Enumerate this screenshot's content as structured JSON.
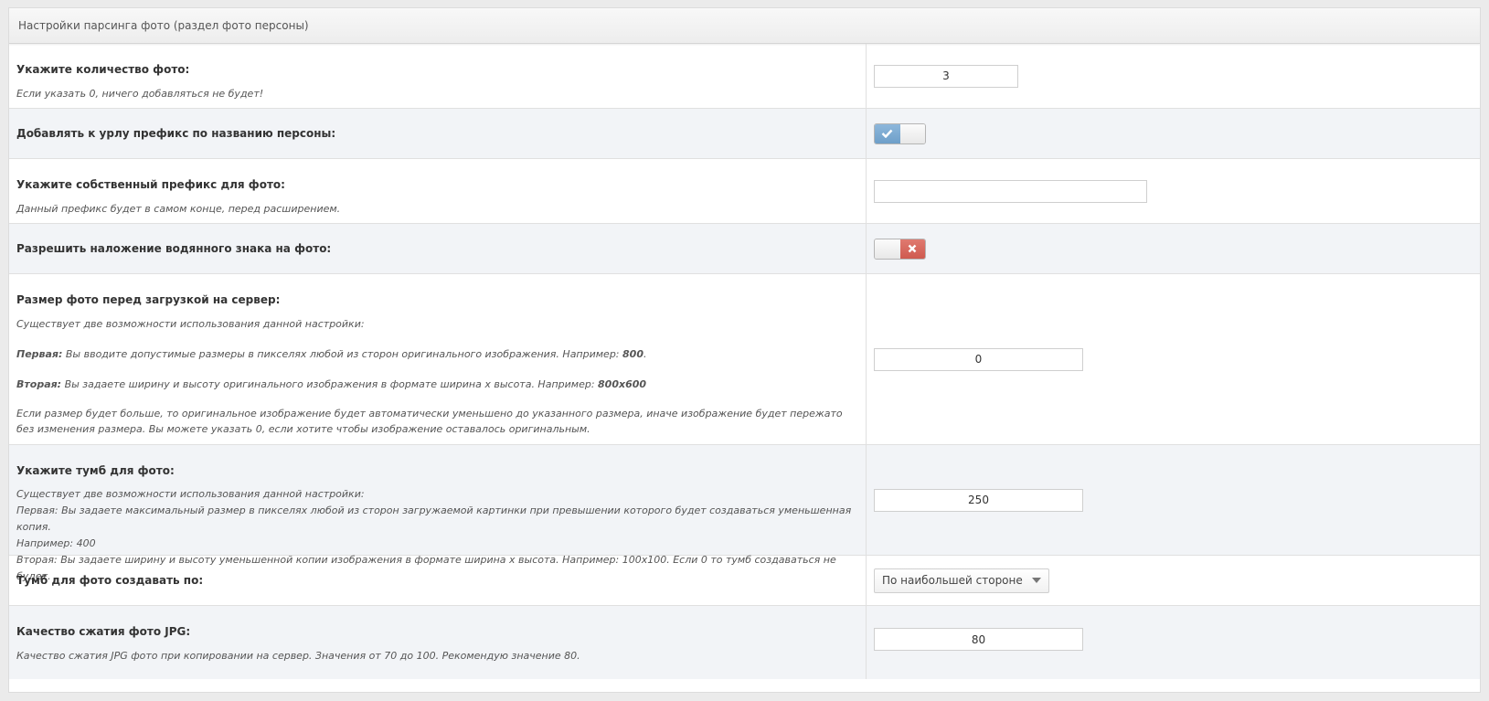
{
  "panel": {
    "title": "Настройки парсинга фото (раздел фото персоны)"
  },
  "rows": {
    "count": {
      "label": "Укажите количество фото:",
      "note": "Если указать 0, ничего добавляться не будет!",
      "value": "3"
    },
    "prefix_toggle": {
      "label": "Добавлять к урлу префикс по названию персоны:",
      "state": "on"
    },
    "custom_prefix": {
      "label": "Укажите собственный префикс для фото:",
      "note": "Данный префикс будет в самом конце, перед расширением.",
      "value": ""
    },
    "watermark": {
      "label": "Разрешить наложение водянного знака на фото:",
      "state": "off"
    },
    "size": {
      "label": "Размер фото перед загрузкой на сервер:",
      "intro": "Существует две возможности использования данной настройки:",
      "first_bold": "Первая:",
      "first_text": " Вы вводите допустимые размеры в пикселях любой из сторон оригинального изображения. Например: ",
      "first_example": "800",
      "second_bold": "Вторая:",
      "second_text": " Вы задаете ширину и высоту оригинального изображения в формате ширина x высота. Например: ",
      "second_example": "800x600",
      "outro": "Если размер будет больше, то оригинальное изображение будет автоматически уменьшено до указанного размера, иначе изображение будет пережато без изменения размера. Вы можете указать 0, если хотите чтобы изображение оставалось оригинальным.",
      "value": "0"
    },
    "thumb": {
      "label": "Укажите тумб для фото:",
      "line1": "Существует две возможности использования данной настройки:",
      "line2": "Первая: Вы задаете максимальный размер в пикселях любой из сторон загружаемой картинки при превышении которого будет создаваться уменьшенная копия.",
      "line3": "Например: 400",
      "line4": "Вторая: Вы задаете ширину и высоту уменьшенной копии изображения в формате ширина x высота. Например: 100x100. Если 0 то тумб создаваться не будет.",
      "value": "250"
    },
    "thumb_by": {
      "label": "Тумб для фото создавать по:",
      "selected": "По наибольшей стороне"
    },
    "quality": {
      "label": "Качество сжатия фото JPG:",
      "note": "Качество сжатия JPG фото при копировании на сервер. Значения от 70 до 100. Рекомендую значение 80.",
      "value": "80"
    }
  },
  "icons": {
    "check": "check-icon",
    "cross": "close-icon",
    "caret": "chevron-down-icon"
  },
  "colors": {
    "toggle_on": "#7aaad3",
    "toggle_off": "#d9665b",
    "row_alt": "#f2f4f7"
  }
}
